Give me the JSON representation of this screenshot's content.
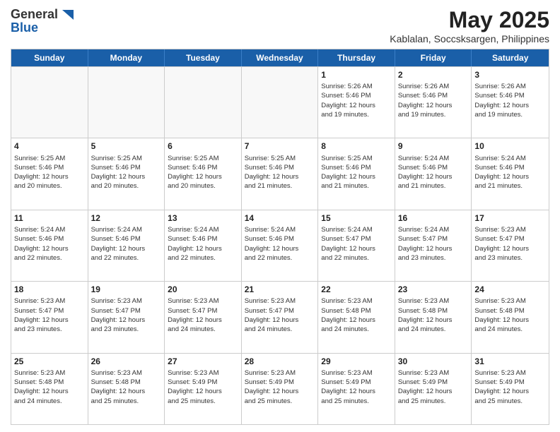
{
  "header": {
    "logo_general": "General",
    "logo_blue": "Blue",
    "month_title": "May 2025",
    "location": "Kablalan, Soccsksargen, Philippines"
  },
  "weekdays": [
    "Sunday",
    "Monday",
    "Tuesday",
    "Wednesday",
    "Thursday",
    "Friday",
    "Saturday"
  ],
  "rows": [
    [
      {
        "day": "",
        "info": ""
      },
      {
        "day": "",
        "info": ""
      },
      {
        "day": "",
        "info": ""
      },
      {
        "day": "",
        "info": ""
      },
      {
        "day": "1",
        "info": "Sunrise: 5:26 AM\nSunset: 5:46 PM\nDaylight: 12 hours\nand 19 minutes."
      },
      {
        "day": "2",
        "info": "Sunrise: 5:26 AM\nSunset: 5:46 PM\nDaylight: 12 hours\nand 19 minutes."
      },
      {
        "day": "3",
        "info": "Sunrise: 5:26 AM\nSunset: 5:46 PM\nDaylight: 12 hours\nand 19 minutes."
      }
    ],
    [
      {
        "day": "4",
        "info": "Sunrise: 5:25 AM\nSunset: 5:46 PM\nDaylight: 12 hours\nand 20 minutes."
      },
      {
        "day": "5",
        "info": "Sunrise: 5:25 AM\nSunset: 5:46 PM\nDaylight: 12 hours\nand 20 minutes."
      },
      {
        "day": "6",
        "info": "Sunrise: 5:25 AM\nSunset: 5:46 PM\nDaylight: 12 hours\nand 20 minutes."
      },
      {
        "day": "7",
        "info": "Sunrise: 5:25 AM\nSunset: 5:46 PM\nDaylight: 12 hours\nand 21 minutes."
      },
      {
        "day": "8",
        "info": "Sunrise: 5:25 AM\nSunset: 5:46 PM\nDaylight: 12 hours\nand 21 minutes."
      },
      {
        "day": "9",
        "info": "Sunrise: 5:24 AM\nSunset: 5:46 PM\nDaylight: 12 hours\nand 21 minutes."
      },
      {
        "day": "10",
        "info": "Sunrise: 5:24 AM\nSunset: 5:46 PM\nDaylight: 12 hours\nand 21 minutes."
      }
    ],
    [
      {
        "day": "11",
        "info": "Sunrise: 5:24 AM\nSunset: 5:46 PM\nDaylight: 12 hours\nand 22 minutes."
      },
      {
        "day": "12",
        "info": "Sunrise: 5:24 AM\nSunset: 5:46 PM\nDaylight: 12 hours\nand 22 minutes."
      },
      {
        "day": "13",
        "info": "Sunrise: 5:24 AM\nSunset: 5:46 PM\nDaylight: 12 hours\nand 22 minutes."
      },
      {
        "day": "14",
        "info": "Sunrise: 5:24 AM\nSunset: 5:46 PM\nDaylight: 12 hours\nand 22 minutes."
      },
      {
        "day": "15",
        "info": "Sunrise: 5:24 AM\nSunset: 5:47 PM\nDaylight: 12 hours\nand 22 minutes."
      },
      {
        "day": "16",
        "info": "Sunrise: 5:24 AM\nSunset: 5:47 PM\nDaylight: 12 hours\nand 23 minutes."
      },
      {
        "day": "17",
        "info": "Sunrise: 5:23 AM\nSunset: 5:47 PM\nDaylight: 12 hours\nand 23 minutes."
      }
    ],
    [
      {
        "day": "18",
        "info": "Sunrise: 5:23 AM\nSunset: 5:47 PM\nDaylight: 12 hours\nand 23 minutes."
      },
      {
        "day": "19",
        "info": "Sunrise: 5:23 AM\nSunset: 5:47 PM\nDaylight: 12 hours\nand 23 minutes."
      },
      {
        "day": "20",
        "info": "Sunrise: 5:23 AM\nSunset: 5:47 PM\nDaylight: 12 hours\nand 24 minutes."
      },
      {
        "day": "21",
        "info": "Sunrise: 5:23 AM\nSunset: 5:47 PM\nDaylight: 12 hours\nand 24 minutes."
      },
      {
        "day": "22",
        "info": "Sunrise: 5:23 AM\nSunset: 5:48 PM\nDaylight: 12 hours\nand 24 minutes."
      },
      {
        "day": "23",
        "info": "Sunrise: 5:23 AM\nSunset: 5:48 PM\nDaylight: 12 hours\nand 24 minutes."
      },
      {
        "day": "24",
        "info": "Sunrise: 5:23 AM\nSunset: 5:48 PM\nDaylight: 12 hours\nand 24 minutes."
      }
    ],
    [
      {
        "day": "25",
        "info": "Sunrise: 5:23 AM\nSunset: 5:48 PM\nDaylight: 12 hours\nand 24 minutes."
      },
      {
        "day": "26",
        "info": "Sunrise: 5:23 AM\nSunset: 5:48 PM\nDaylight: 12 hours\nand 25 minutes."
      },
      {
        "day": "27",
        "info": "Sunrise: 5:23 AM\nSunset: 5:49 PM\nDaylight: 12 hours\nand 25 minutes."
      },
      {
        "day": "28",
        "info": "Sunrise: 5:23 AM\nSunset: 5:49 PM\nDaylight: 12 hours\nand 25 minutes."
      },
      {
        "day": "29",
        "info": "Sunrise: 5:23 AM\nSunset: 5:49 PM\nDaylight: 12 hours\nand 25 minutes."
      },
      {
        "day": "30",
        "info": "Sunrise: 5:23 AM\nSunset: 5:49 PM\nDaylight: 12 hours\nand 25 minutes."
      },
      {
        "day": "31",
        "info": "Sunrise: 5:23 AM\nSunset: 5:49 PM\nDaylight: 12 hours\nand 25 minutes."
      }
    ]
  ]
}
